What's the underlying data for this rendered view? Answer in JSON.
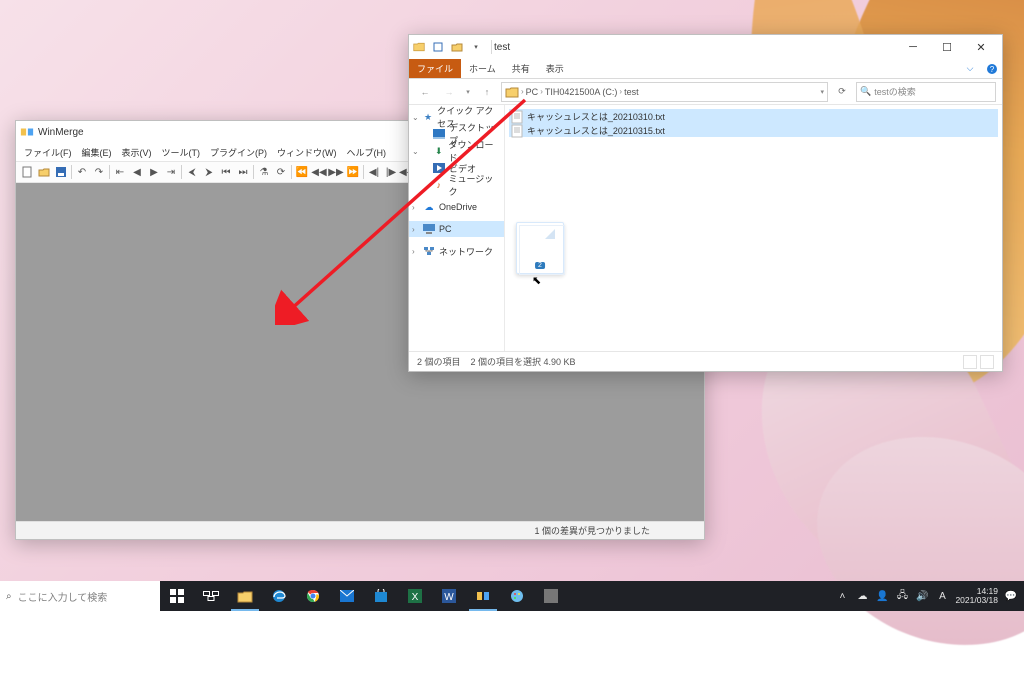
{
  "winmerge": {
    "title": "WinMerge",
    "menu": [
      "ファイル(F)",
      "編集(E)",
      "表示(V)",
      "ツール(T)",
      "プラグイン(P)",
      "ウィンドウ(W)",
      "ヘルプ(H)"
    ],
    "status_right": "1 個の差異が見つかりました"
  },
  "explorer": {
    "title": "test",
    "tabs": {
      "file": "ファイル",
      "home": "ホーム",
      "share": "共有",
      "view": "表示"
    },
    "crumbs": [
      "PC",
      "TIH0421500A (C:)",
      "test"
    ],
    "search_placeholder": "testの検索",
    "sidebar": [
      {
        "label": "クイック アクセス",
        "icon": "star",
        "expand": true
      },
      {
        "label": "デスクトップ",
        "icon": "desktop",
        "child": true
      },
      {
        "label": "ダウンロード",
        "icon": "download",
        "child": true
      },
      {
        "label": "ビデオ",
        "icon": "video",
        "child": true
      },
      {
        "label": "ミュージック",
        "icon": "music",
        "child": true
      },
      {
        "label": "OneDrive",
        "icon": "cloud",
        "expand": true
      },
      {
        "label": "PC",
        "icon": "pc",
        "expand": true,
        "selected": true
      },
      {
        "label": "ネットワーク",
        "icon": "network",
        "expand": true
      }
    ],
    "files": [
      {
        "name": "キャッシュレスとは_20210310.txt",
        "selected": true
      },
      {
        "name": "キャッシュレスとは_20210315.txt",
        "selected": true
      }
    ],
    "status": {
      "count": "2 個の項目",
      "selected": "2 個の項目を選択 4.90 KB"
    },
    "drag_badge": "2"
  },
  "taskbar": {
    "search_placeholder": "ここに入力して検索",
    "tray": {
      "ime": "A",
      "time": "14:19",
      "date": "2021/03/18"
    }
  }
}
